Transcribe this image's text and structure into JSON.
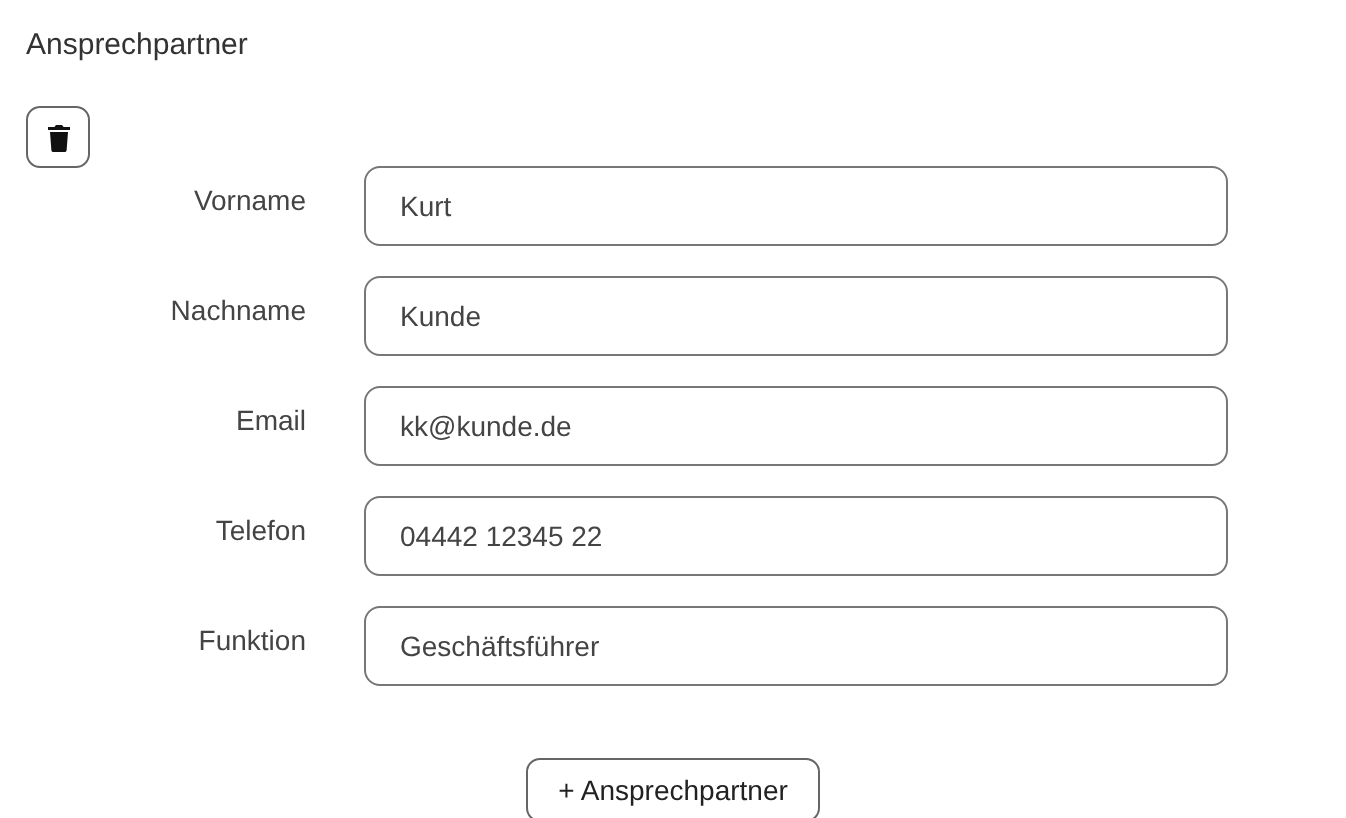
{
  "section": {
    "title": "Ansprechpartner"
  },
  "fields": [
    {
      "label": "Vorname",
      "value": "Kurt"
    },
    {
      "label": "Nachname",
      "value": "Kunde"
    },
    {
      "label": "Email",
      "value": "kk@kunde.de"
    },
    {
      "label": "Telefon",
      "value": "04442 12345 22"
    },
    {
      "label": "Funktion",
      "value": "Geschäftsführer"
    }
  ],
  "add_button": {
    "label": "+ Ansprechpartner"
  }
}
